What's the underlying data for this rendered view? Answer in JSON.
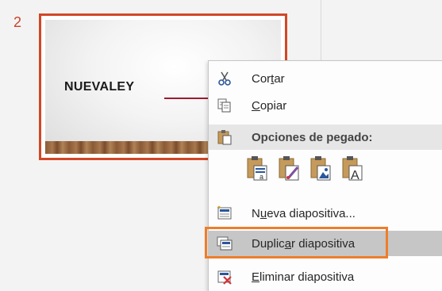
{
  "slide_panel": {
    "slide_number": "2",
    "thumbnail_title": "NUEVALEY"
  },
  "context_menu": {
    "cut": {
      "before": "Cor",
      "accel": "t",
      "after": "ar"
    },
    "copy": {
      "before": "",
      "accel": "C",
      "after": "opiar"
    },
    "paste_options_header": "Opciones de pegado:",
    "new_slide": {
      "before": "N",
      "accel": "u",
      "after": "eva diapositiva..."
    },
    "duplicate_slide": {
      "before": "Duplic",
      "accel": "a",
      "after": "r diapositiva"
    },
    "delete_slide": {
      "before": "",
      "accel": "E",
      "after": "liminar diapositiva"
    }
  },
  "colors": {
    "slide_border": "#d24726",
    "highlight_outline": "#ee7d2b",
    "highlight_fill": "#c6c6c6",
    "icon_blue": "#2b579a",
    "icon_red": "#d13438"
  },
  "icons": [
    "scissors-icon",
    "copy-icon",
    "clipboard-icon",
    "paste-keep-source-icon",
    "paste-destination-theme-icon",
    "paste-picture-icon",
    "paste-text-only-icon",
    "new-slide-icon",
    "duplicate-slide-icon",
    "delete-slide-icon"
  ]
}
